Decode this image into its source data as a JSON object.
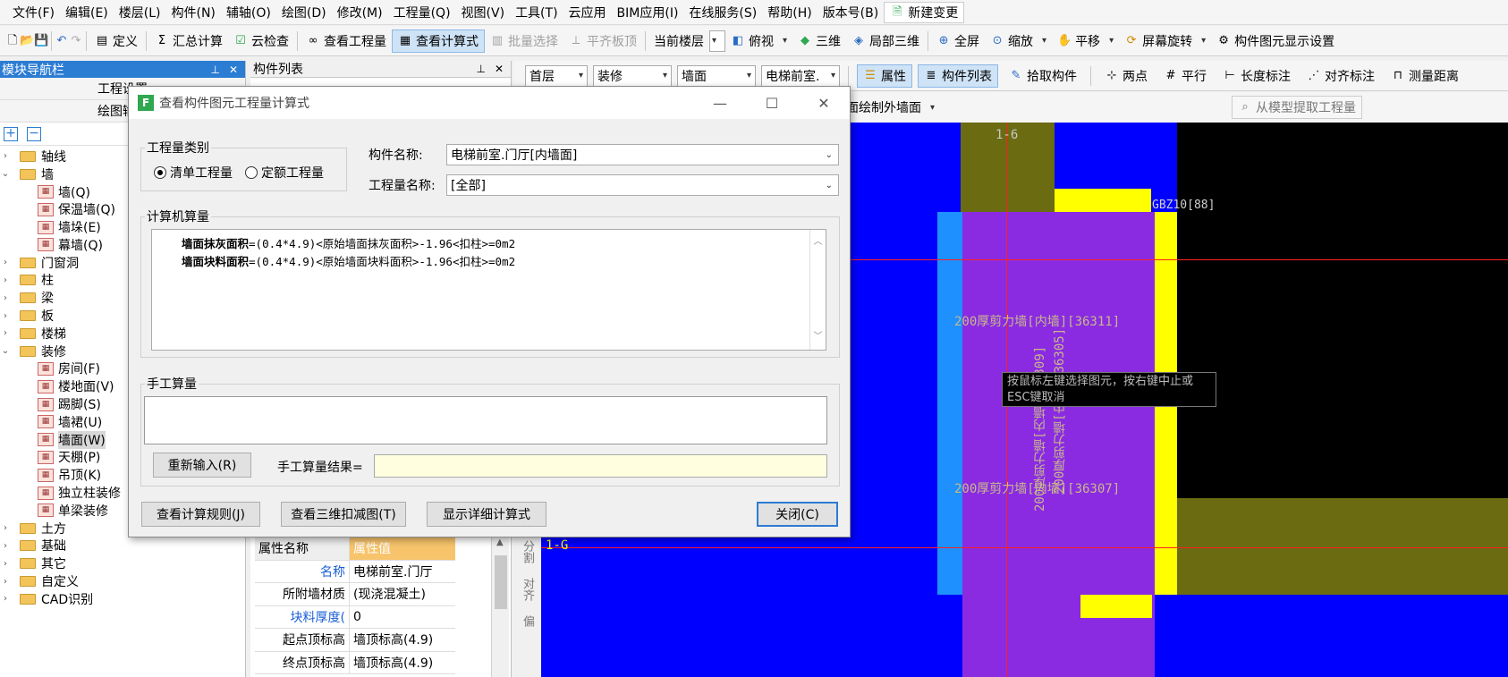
{
  "menubar": {
    "items": [
      "文件(F)",
      "编辑(E)",
      "楼层(L)",
      "构件(N)",
      "辅轴(O)",
      "绘图(D)",
      "修改(M)",
      "工程量(Q)",
      "视图(V)",
      "工具(T)",
      "云应用",
      "BIM应用(I)",
      "在线服务(S)",
      "帮助(H)",
      "版本号(B)"
    ],
    "new_change": "新建变更"
  },
  "toolbar": {
    "define": "定义",
    "sum_calc": "汇总计算",
    "cloud_check": "云检查",
    "view_quantity": "查看工程量",
    "view_formula": "查看计算式",
    "batch_select": "批量选择",
    "flush_slab": "平齐板顶",
    "current_floor": "当前楼层",
    "top_view": "俯视",
    "three_d": "三维",
    "local_3d": "局部三维",
    "full_screen": "全屏",
    "zoom": "缩放",
    "pan": "平移",
    "screen_rotate": "屏幕旋转",
    "display_settings": "构件图元显示设置"
  },
  "left_panel": {
    "title": "模块导航栏",
    "btn_project_settings": "工程设置",
    "btn_draw_input": "绘图输入",
    "tree": [
      {
        "label": "轴线",
        "level": 0,
        "expanded": false
      },
      {
        "label": "墙",
        "level": 0,
        "expanded": true
      },
      {
        "label": "墙(Q)",
        "level": 1
      },
      {
        "label": "保温墙(Q)",
        "level": 1
      },
      {
        "label": "墙垛(E)",
        "level": 1
      },
      {
        "label": "幕墙(Q)",
        "level": 1
      },
      {
        "label": "门窗洞",
        "level": 0,
        "expanded": false
      },
      {
        "label": "柱",
        "level": 0,
        "expanded": false
      },
      {
        "label": "梁",
        "level": 0,
        "expanded": false
      },
      {
        "label": "板",
        "level": 0,
        "expanded": false
      },
      {
        "label": "楼梯",
        "level": 0,
        "expanded": false
      },
      {
        "label": "装修",
        "level": 0,
        "expanded": true
      },
      {
        "label": "房间(F)",
        "level": 1
      },
      {
        "label": "楼地面(V)",
        "level": 1
      },
      {
        "label": "踢脚(S)",
        "level": 1
      },
      {
        "label": "墙裙(U)",
        "level": 1
      },
      {
        "label": "墙面(W)",
        "level": 1,
        "selected": true
      },
      {
        "label": "天棚(P)",
        "level": 1
      },
      {
        "label": "吊顶(K)",
        "level": 1
      },
      {
        "label": "独立柱装修",
        "level": 1
      },
      {
        "label": "单梁装修",
        "level": 1
      },
      {
        "label": "土方",
        "level": 0,
        "expanded": false
      },
      {
        "label": "基础",
        "level": 0,
        "expanded": false
      },
      {
        "label": "其它",
        "level": 0,
        "expanded": false
      },
      {
        "label": "自定义",
        "level": 0,
        "expanded": false
      },
      {
        "label": "CAD识别",
        "level": 0,
        "expanded": false
      }
    ]
  },
  "component_list": {
    "title": "构件列表"
  },
  "toolbar2": {
    "floor": "首层",
    "category": "装修",
    "type": "墙面",
    "component": "电梯前室.",
    "properties": "属性",
    "component_list": "构件列表",
    "pick": "拾取构件",
    "two_points": "两点",
    "parallel": "平行",
    "length_dim": "长度标注",
    "align_dim": "对齐标注",
    "measure": "测量距离"
  },
  "toolbar3": {
    "draw_outer_wall": "面绘制外墙面",
    "extract_quantity": "从模型提取工程量"
  },
  "properties": {
    "header_name": "属性名称",
    "header_value": "属性值",
    "rows": [
      {
        "name": "名称",
        "value": "电梯前室.门厅",
        "blue": true
      },
      {
        "name": "所附墙材质",
        "value": "(现浇混凝土)",
        "blue": false
      },
      {
        "name": "块料厚度(",
        "value": "0",
        "blue": true
      },
      {
        "name": "起点顶标高",
        "value": "墙顶标高(4.9)",
        "blue": false
      },
      {
        "name": "终点顶标高",
        "value": "墙顶标高(4.9)",
        "blue": false
      }
    ]
  },
  "side_strip": [
    "分割",
    "对齐",
    "偏"
  ],
  "canvas": {
    "axis_top": "1-6",
    "axis_left": "1-G",
    "gbz": "GBZ10[88]",
    "wall_label_1": "200厚剪力墙[内墙][36311]",
    "wall_label_2": "200厚剪力墙[内墙][36307]",
    "vertical_1": "200厚剪力墙[内墙][36309]",
    "vertical_2": "200厚剪力墙[内墙][36305]",
    "tooltip": "按鼠标左键选择图元，按右键中止或ESC键取消"
  },
  "dialog": {
    "title": "查看构件图元工程量计算式",
    "group_type": "工程量类别",
    "radio_list": "清单工程量",
    "radio_quota": "定额工程量",
    "label_component": "构件名称:",
    "component_value": "电梯前室.门厅[内墙面]",
    "label_quantity": "工程量名称:",
    "quantity_value": "[全部]",
    "group_computer": "计算机算量",
    "formula_1_name": "墙面抹灰面积",
    "formula_1_expr": "=(0.4*4.9)<原始墙面抹灰面积>-1.96<扣柱>=0m2",
    "formula_2_name": "墙面块料面积",
    "formula_2_expr": "=(0.4*4.9)<原始墙面块料面积>-1.96<扣柱>=0m2",
    "group_manual": "手工算量",
    "btn_reinput": "重新输入(R)",
    "manual_result_label": "手工算量结果=",
    "btn_rules": "查看计算规则(J)",
    "btn_3d_deduct": "查看三维扣减图(T)",
    "btn_detail": "显示详细计算式",
    "btn_close": "关闭(C)"
  },
  "colors": {
    "canvas_bg": "#0000ff",
    "wall_purple": "#8a2be2",
    "yellow": "#ffff00",
    "olive": "#6b6b12",
    "light_blue": "#1e90ff"
  }
}
